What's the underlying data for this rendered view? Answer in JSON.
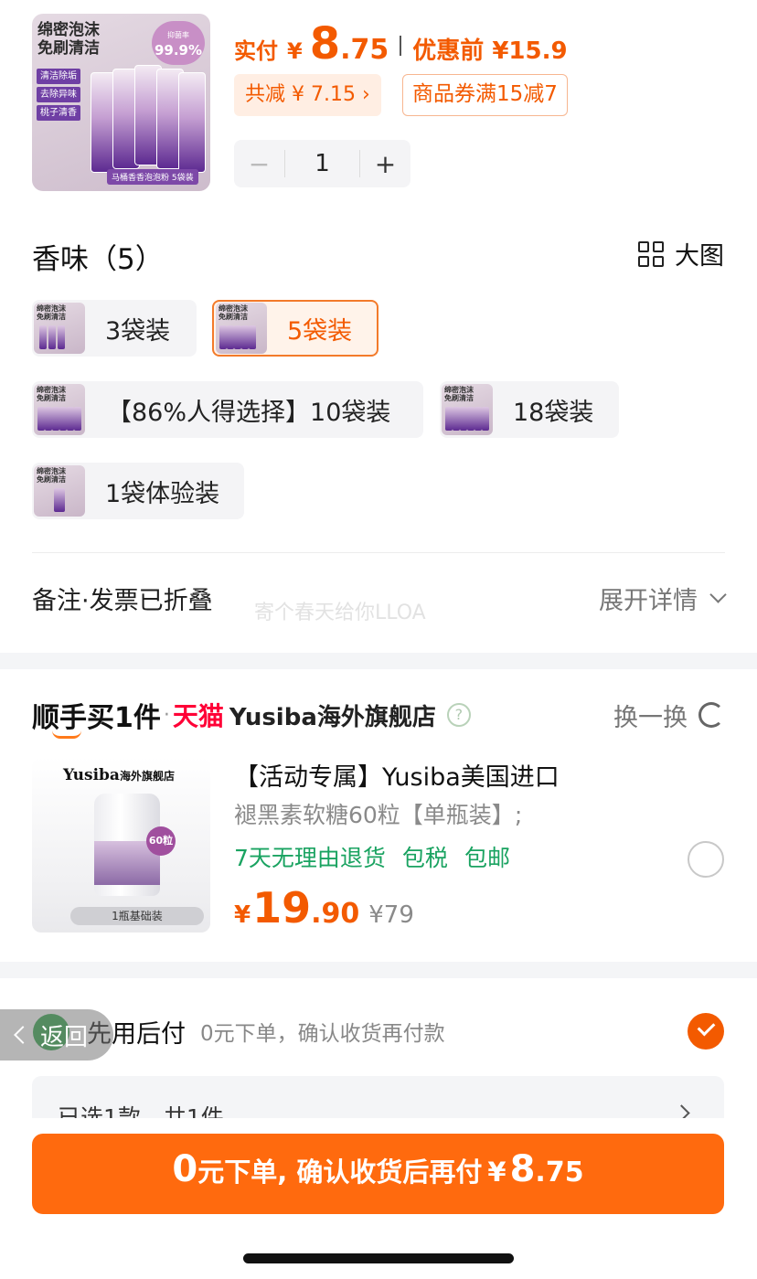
{
  "product": {
    "thumb": {
      "headline": "绵密泡沫\n免刷清洁",
      "percent": "99.9%",
      "percent_caption": "抑菌率",
      "chips": [
        "清洁除垢",
        "去除异味",
        "桃子清香"
      ],
      "caption": "马桶香香泡泡粉 5袋装"
    },
    "price_label": "实付",
    "currency": "¥",
    "price_int": "8",
    "price_dec": ".75",
    "orig_label": "优惠前 ¥15.9",
    "reduce_label": "共减 ¥ 7.15 ›",
    "coupon_label": "商品券满15减7",
    "quantity": "1",
    "minus": "−",
    "plus": "+"
  },
  "scent": {
    "title": "香味（5）",
    "view_label": "大图",
    "options": [
      {
        "label": "3袋装",
        "selected": false
      },
      {
        "label": "5袋装",
        "selected": true
      },
      {
        "label": "【86%人得选择】10袋装",
        "selected": false
      },
      {
        "label": "18袋装",
        "selected": false
      },
      {
        "label": "1袋体验装",
        "selected": false
      }
    ],
    "mini_caption": "绵密泡沫\n免刷清洁"
  },
  "note": {
    "left": "备注·发票已折叠",
    "right": "展开详情",
    "watermark": "寄个春天给你LLOA"
  },
  "smooth_buy": {
    "logo": "顺手买1件",
    "dot": "·",
    "platform": "天猫",
    "store": "Yusiba海外旗舰店",
    "help": "?",
    "swap_label": "换一换",
    "item": {
      "img_brand": "Yusiba",
      "img_brand_suffix": "海外旗舰店",
      "img_count": "60粒",
      "img_pill": "1瓶基础装",
      "title": "【活动专属】Yusiba美国进口",
      "subtitle": "褪黑素软糖60粒【单瓶装】;",
      "tags": [
        "7天无理由退货",
        "包税",
        "包邮"
      ],
      "currency": "¥",
      "price_int": "19",
      "price_dec": ".90",
      "orig_price": "¥79"
    }
  },
  "pay_later": {
    "title": "先用后付",
    "desc": "0元下单，确认收货再付款",
    "checked": true,
    "back_label": "返回",
    "selected_summary": "已选1款　共1件"
  },
  "cta": {
    "zero": "0",
    "text": "元下单, 确认收货后再付",
    "currency": "¥",
    "price_int": "8",
    "price_dec": ".75"
  },
  "colors": {
    "accent": "#f35a00",
    "button": "#ff6a0e",
    "green": "#1aa361",
    "tmall": "#ff0036"
  }
}
